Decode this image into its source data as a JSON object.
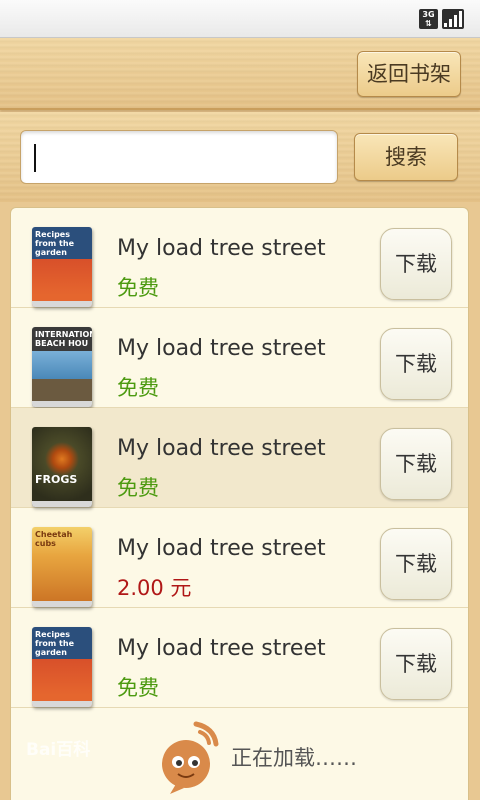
{
  "status": {
    "network": "3G",
    "signal_icon": "signal-icon"
  },
  "header": {
    "back_label": "返回书架"
  },
  "search": {
    "value": "",
    "button_label": "搜索"
  },
  "books": [
    {
      "title": "My load tree street",
      "price": "免费",
      "price_type": "free",
      "download_label": "下载",
      "cover_text": "Recipes from the garden",
      "cover_color": "#2b4f7c"
    },
    {
      "title": "My load tree street",
      "price": "免费",
      "price_type": "free",
      "download_label": "下载",
      "cover_text": "INTERNATIONAL BEACH HOU",
      "cover_color": "#3a3a3a"
    },
    {
      "title": "My load tree street",
      "price": "免费",
      "price_type": "free",
      "download_label": "下载",
      "cover_text": "FROGS",
      "cover_color": "#3d3a22"
    },
    {
      "title": "My load tree street",
      "price": "2.00 元",
      "price_type": "paid",
      "download_label": "下载",
      "cover_text": "Cheetah cubs",
      "cover_color": "#d98a2a"
    },
    {
      "title": "My load tree street",
      "price": "免费",
      "price_type": "free",
      "download_label": "下载",
      "cover_text": "Recipes from the garden",
      "cover_color": "#2b4f7c"
    }
  ],
  "loading": {
    "text": "正在加载……"
  },
  "watermark": {
    "text": "Bai百科"
  },
  "colors": {
    "free": "#4c9a10",
    "paid": "#b01717",
    "accent": "#e8c892"
  }
}
